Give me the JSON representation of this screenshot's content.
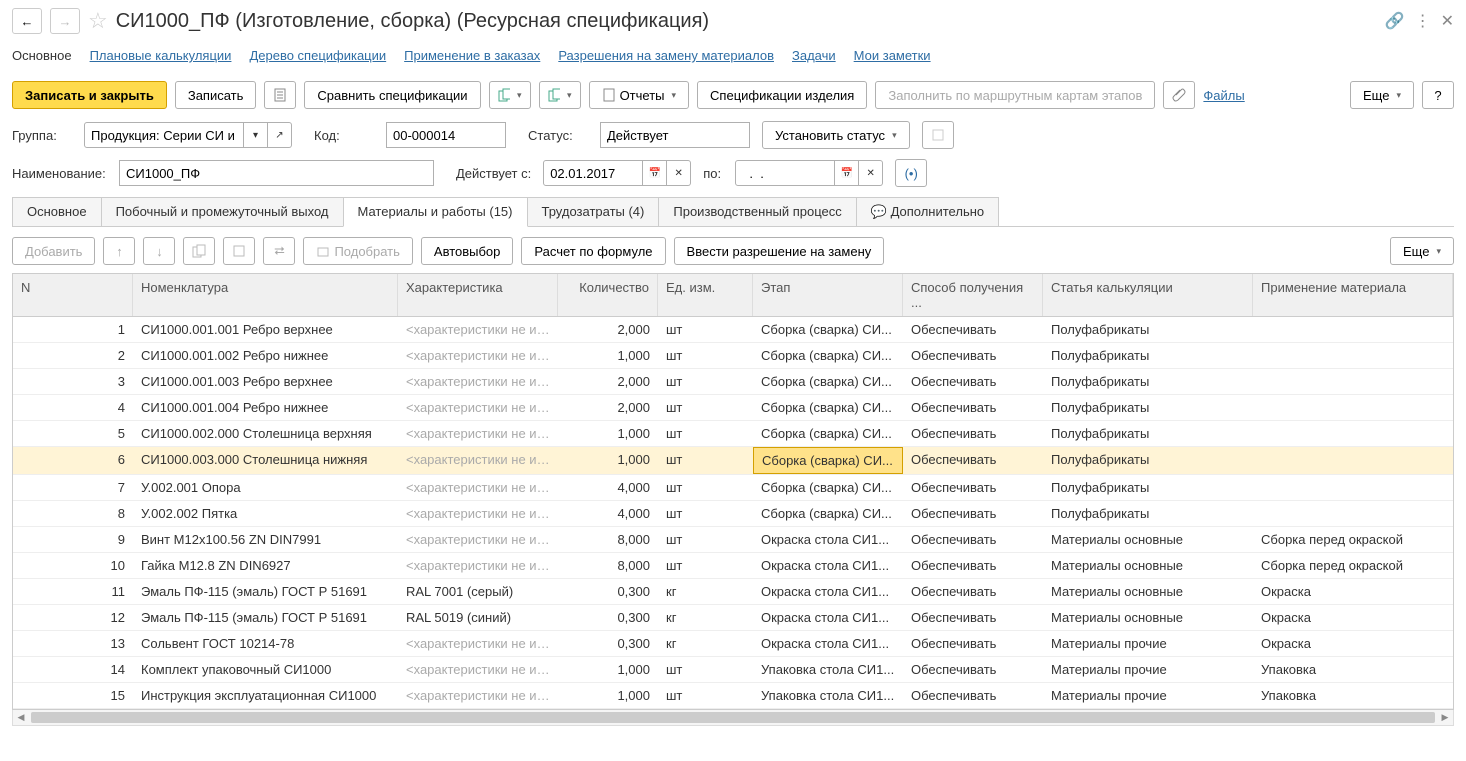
{
  "header": {
    "title": "СИ1000_ПФ (Изготовление, сборка) (Ресурсная спецификация)"
  },
  "nav": {
    "main": "Основное",
    "links": [
      "Плановые калькуляции",
      "Дерево спецификации",
      "Применение в заказах",
      "Разрешения на замену материалов",
      "Задачи",
      "Мои заметки"
    ]
  },
  "toolbar": {
    "save_close": "Записать и закрыть",
    "save": "Записать",
    "compare": "Сравнить спецификации",
    "reports": "Отчеты",
    "spec_item": "Спецификации изделия",
    "fill_route": "Заполнить по маршрутным картам этапов",
    "files": "Файлы",
    "more": "Еще",
    "help": "?"
  },
  "form": {
    "group_lbl": "Группа:",
    "group_val": "Продукция: Серии СИ и Т",
    "code_lbl": "Код:",
    "code_val": "00-000014",
    "status_lbl": "Статус:",
    "status_val": "Действует",
    "set_status": "Установить статус",
    "name_lbl": "Наименование:",
    "name_val": "СИ1000_ПФ",
    "valid_from_lbl": "Действует с:",
    "valid_from_val": "02.01.2017",
    "to_lbl": "по:",
    "to_val": "  .  .    "
  },
  "tabs": [
    {
      "label": "Основное"
    },
    {
      "label": "Побочный и промежуточный выход"
    },
    {
      "label": "Материалы и работы (15)",
      "active": true
    },
    {
      "label": "Трудозатраты (4)"
    },
    {
      "label": "Производственный процесс"
    },
    {
      "label": "Дополнительно",
      "icon": true
    }
  ],
  "subtb": {
    "add": "Добавить",
    "pick": "Подобрать",
    "auto": "Автовыбор",
    "formula": "Расчет по формуле",
    "replace": "Ввести разрешение на замену",
    "more": "Еще"
  },
  "cols": {
    "n": "N",
    "nom": "Номенклатура",
    "char": "Характеристика",
    "qty": "Количество",
    "unit": "Ед. изм.",
    "stage": "Этап",
    "method": "Способ получения ...",
    "calc": "Статья калькуляции",
    "app": "Применение материала"
  },
  "char_ph": "<характеристики не ис...",
  "rows": [
    {
      "n": "1",
      "nom": "СИ1000.001.001 Ребро верхнее",
      "char": "",
      "qty": "2,000",
      "unit": "шт",
      "stage": "Сборка (сварка) СИ...",
      "method": "Обеспечивать",
      "calc": "Полуфабрикаты",
      "app": ""
    },
    {
      "n": "2",
      "nom": "СИ1000.001.002 Ребро нижнее",
      "char": "",
      "qty": "1,000",
      "unit": "шт",
      "stage": "Сборка (сварка) СИ...",
      "method": "Обеспечивать",
      "calc": "Полуфабрикаты",
      "app": ""
    },
    {
      "n": "3",
      "nom": "СИ1000.001.003 Ребро верхнее",
      "char": "",
      "qty": "2,000",
      "unit": "шт",
      "stage": "Сборка (сварка) СИ...",
      "method": "Обеспечивать",
      "calc": "Полуфабрикаты",
      "app": ""
    },
    {
      "n": "4",
      "nom": "СИ1000.001.004 Ребро нижнее",
      "char": "",
      "qty": "2,000",
      "unit": "шт",
      "stage": "Сборка (сварка) СИ...",
      "method": "Обеспечивать",
      "calc": "Полуфабрикаты",
      "app": ""
    },
    {
      "n": "5",
      "nom": "СИ1000.002.000 Столешница верхняя",
      "char": "",
      "qty": "1,000",
      "unit": "шт",
      "stage": "Сборка (сварка) СИ...",
      "method": "Обеспечивать",
      "calc": "Полуфабрикаты",
      "app": ""
    },
    {
      "n": "6",
      "nom": "СИ1000.003.000 Столешница нижняя",
      "char": "",
      "qty": "1,000",
      "unit": "шт",
      "stage": "Сборка (сварка) СИ...",
      "method": "Обеспечивать",
      "calc": "Полуфабрикаты",
      "app": "",
      "selected": true
    },
    {
      "n": "7",
      "nom": "У.002.001 Опора",
      "char": "",
      "qty": "4,000",
      "unit": "шт",
      "stage": "Сборка (сварка) СИ...",
      "method": "Обеспечивать",
      "calc": "Полуфабрикаты",
      "app": ""
    },
    {
      "n": "8",
      "nom": "У.002.002 Пятка",
      "char": "",
      "qty": "4,000",
      "unit": "шт",
      "stage": "Сборка (сварка) СИ...",
      "method": "Обеспечивать",
      "calc": "Полуфабрикаты",
      "app": ""
    },
    {
      "n": "9",
      "nom": "Винт М12х100.56 ZN DIN7991",
      "char": "",
      "qty": "8,000",
      "unit": "шт",
      "stage": "Окраска стола СИ1...",
      "method": "Обеспечивать",
      "calc": "Материалы основные",
      "app": "Сборка перед окраской"
    },
    {
      "n": "10",
      "nom": "Гайка М12.8 ZN DIN6927",
      "char": "",
      "qty": "8,000",
      "unit": "шт",
      "stage": "Окраска стола СИ1...",
      "method": "Обеспечивать",
      "calc": "Материалы основные",
      "app": "Сборка перед окраской"
    },
    {
      "n": "11",
      "nom": "Эмаль ПФ-115 (эмаль) ГОСТ Р 51691",
      "char": "RAL 7001 (серый)",
      "qty": "0,300",
      "unit": "кг",
      "stage": "Окраска стола СИ1...",
      "method": "Обеспечивать",
      "calc": "Материалы основные",
      "app": "Окраска"
    },
    {
      "n": "12",
      "nom": "Эмаль ПФ-115 (эмаль) ГОСТ Р 51691",
      "char": "RAL 5019 (синий)",
      "qty": "0,300",
      "unit": "кг",
      "stage": "Окраска стола СИ1...",
      "method": "Обеспечивать",
      "calc": "Материалы основные",
      "app": "Окраска"
    },
    {
      "n": "13",
      "nom": "Сольвент ГОСТ 10214-78",
      "char": "",
      "qty": "0,300",
      "unit": "кг",
      "stage": "Окраска стола СИ1...",
      "method": "Обеспечивать",
      "calc": "Материалы прочие",
      "app": "Окраска"
    },
    {
      "n": "14",
      "nom": "Комплект упаковочный СИ1000",
      "char": "",
      "qty": "1,000",
      "unit": "шт",
      "stage": "Упаковка стола СИ1...",
      "method": "Обеспечивать",
      "calc": "Материалы прочие",
      "app": "Упаковка"
    },
    {
      "n": "15",
      "nom": "Инструкция эксплуатационная СИ1000",
      "char": "",
      "qty": "1,000",
      "unit": "шт",
      "stage": "Упаковка стола СИ1...",
      "method": "Обеспечивать",
      "calc": "Материалы прочие",
      "app": "Упаковка"
    }
  ]
}
